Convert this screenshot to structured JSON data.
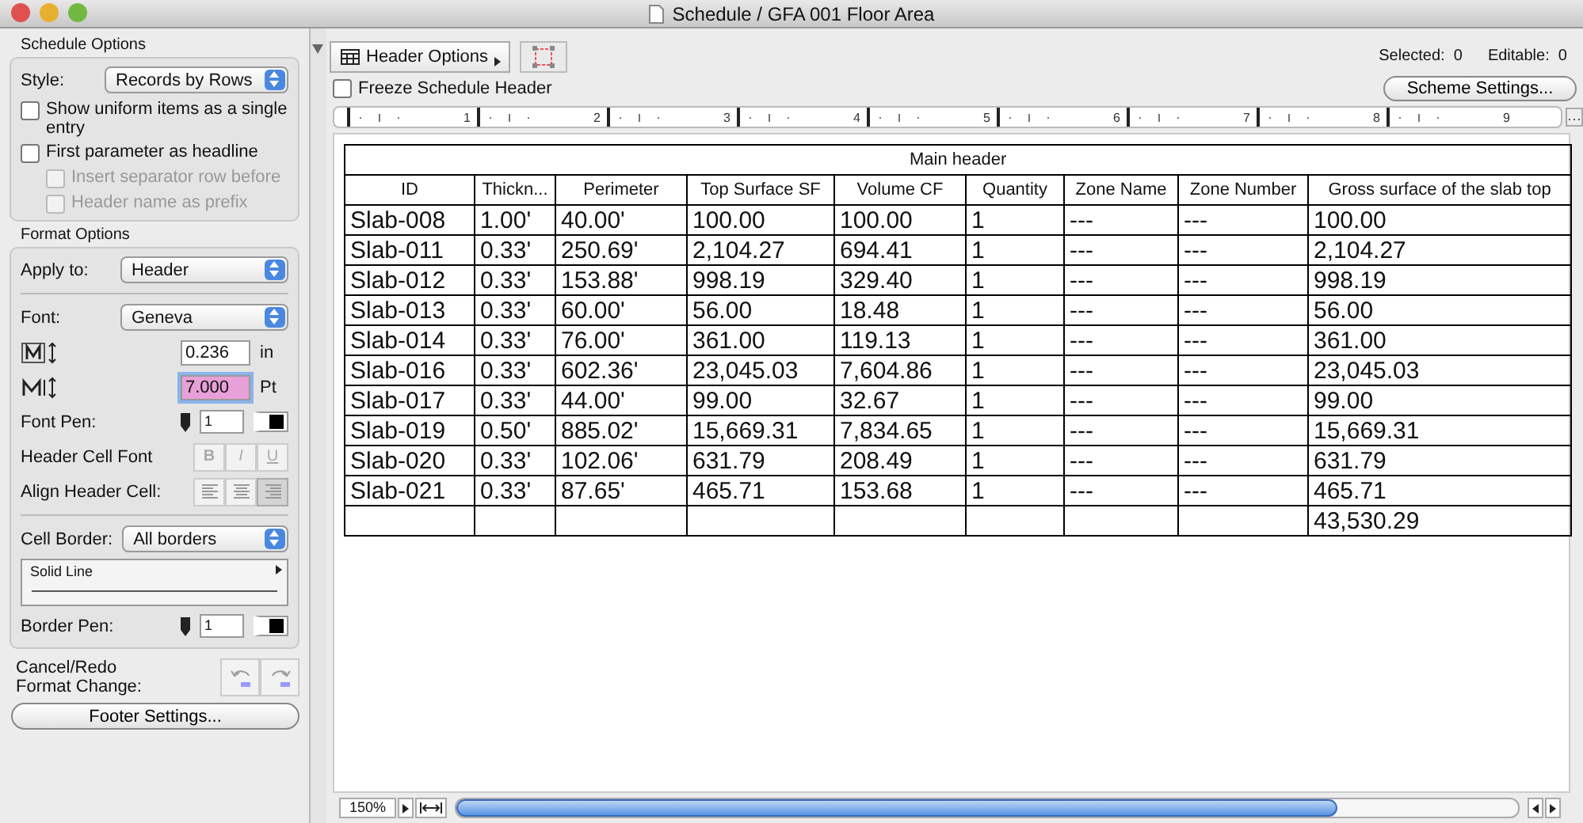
{
  "window": {
    "title": "Schedule / GFA 001 Floor Area"
  },
  "schedule_options": {
    "title": "Schedule Options",
    "style_label": "Style:",
    "style_value": "Records by Rows",
    "checkboxes": [
      {
        "label": "Show uniform items as a single entry",
        "checked": false,
        "disabled": false
      },
      {
        "label": "First parameter as headline",
        "checked": false,
        "disabled": false,
        "children": [
          {
            "label": "Insert separator row before",
            "checked": false,
            "disabled": true
          },
          {
            "label": "Header name as prefix",
            "checked": false,
            "disabled": true
          }
        ]
      }
    ]
  },
  "format_options": {
    "title": "Format Options",
    "apply_label": "Apply to:",
    "apply_value": "Header",
    "font_label": "Font:",
    "font_value": "Geneva",
    "size_width": {
      "value": "0.236",
      "unit": "in"
    },
    "size_height": {
      "value": "7.000",
      "unit": "Pt",
      "highlighted": true
    },
    "font_pen_label": "Font Pen:",
    "font_pen": "1",
    "header_cell_font_label": "Header Cell Font",
    "style_buttons": [
      {
        "label": "B",
        "selected": false
      },
      {
        "label": "I",
        "selected": false
      },
      {
        "label": "U",
        "selected": false
      }
    ],
    "align_label": "Align Header Cell:",
    "align_buttons": [
      {
        "kind": "left",
        "selected": false
      },
      {
        "kind": "center",
        "selected": false
      },
      {
        "kind": "right",
        "selected": true
      }
    ],
    "cell_border_label": "Cell Border:",
    "cell_border_value": "All borders",
    "line_type": "Solid Line",
    "border_pen_label": "Border Pen:",
    "border_pen": "1"
  },
  "undo": {
    "label": "Cancel/Redo\nFormat Change:"
  },
  "footer_button": "Footer Settings...",
  "toolbar": {
    "header_options": "Header Options",
    "freeze_label": "Freeze Schedule Header",
    "freeze_checked": false,
    "selected_label": "Selected:",
    "selected_value": "0",
    "editable_label": "Editable:",
    "editable_value": "0",
    "scheme_button": "Scheme Settings..."
  },
  "ruler": [
    "1",
    "2",
    "3",
    "4",
    "5",
    "6",
    "7",
    "8",
    "9"
  ],
  "table": {
    "main_header": "Main header",
    "columns": [
      "ID",
      "Thickn...",
      "Perimeter",
      "Top Surface SF",
      "Volume CF",
      "Quantity",
      "Zone Name",
      "Zone Number",
      "Gross surface of the slab top"
    ],
    "rows": [
      [
        "Slab-008",
        "1.00'",
        "40.00'",
        "100.00",
        "100.00",
        "1",
        "---",
        "---",
        "100.00"
      ],
      [
        "Slab-011",
        "0.33'",
        "250.69'",
        "2,104.27",
        "694.41",
        "1",
        "---",
        "---",
        "2,104.27"
      ],
      [
        "Slab-012",
        "0.33'",
        "153.88'",
        "998.19",
        "329.40",
        "1",
        "---",
        "---",
        "998.19"
      ],
      [
        "Slab-013",
        "0.33'",
        "60.00'",
        "56.00",
        "18.48",
        "1",
        "---",
        "---",
        "56.00"
      ],
      [
        "Slab-014",
        "0.33'",
        "76.00'",
        "361.00",
        "119.13",
        "1",
        "---",
        "---",
        "361.00"
      ],
      [
        "Slab-016",
        "0.33'",
        "602.36'",
        "23,045.03",
        "7,604.86",
        "1",
        "---",
        "---",
        "23,045.03"
      ],
      [
        "Slab-017",
        "0.33'",
        "44.00'",
        "99.00",
        "32.67",
        "1",
        "---",
        "---",
        "99.00"
      ],
      [
        "Slab-019",
        "0.50'",
        "885.02'",
        "15,669.31",
        "7,834.65",
        "1",
        "---",
        "---",
        "15,669.31"
      ],
      [
        "Slab-020",
        "0.33'",
        "102.06'",
        "631.79",
        "208.49",
        "1",
        "---",
        "---",
        "631.79"
      ],
      [
        "Slab-021",
        "0.33'",
        "87.65'",
        "465.71",
        "153.68",
        "1",
        "---",
        "---",
        "465.71"
      ],
      [
        "",
        "",
        "",
        "",
        "",
        "",
        "",
        "",
        "43,530.29"
      ]
    ]
  },
  "status": {
    "zoom": "150%"
  }
}
